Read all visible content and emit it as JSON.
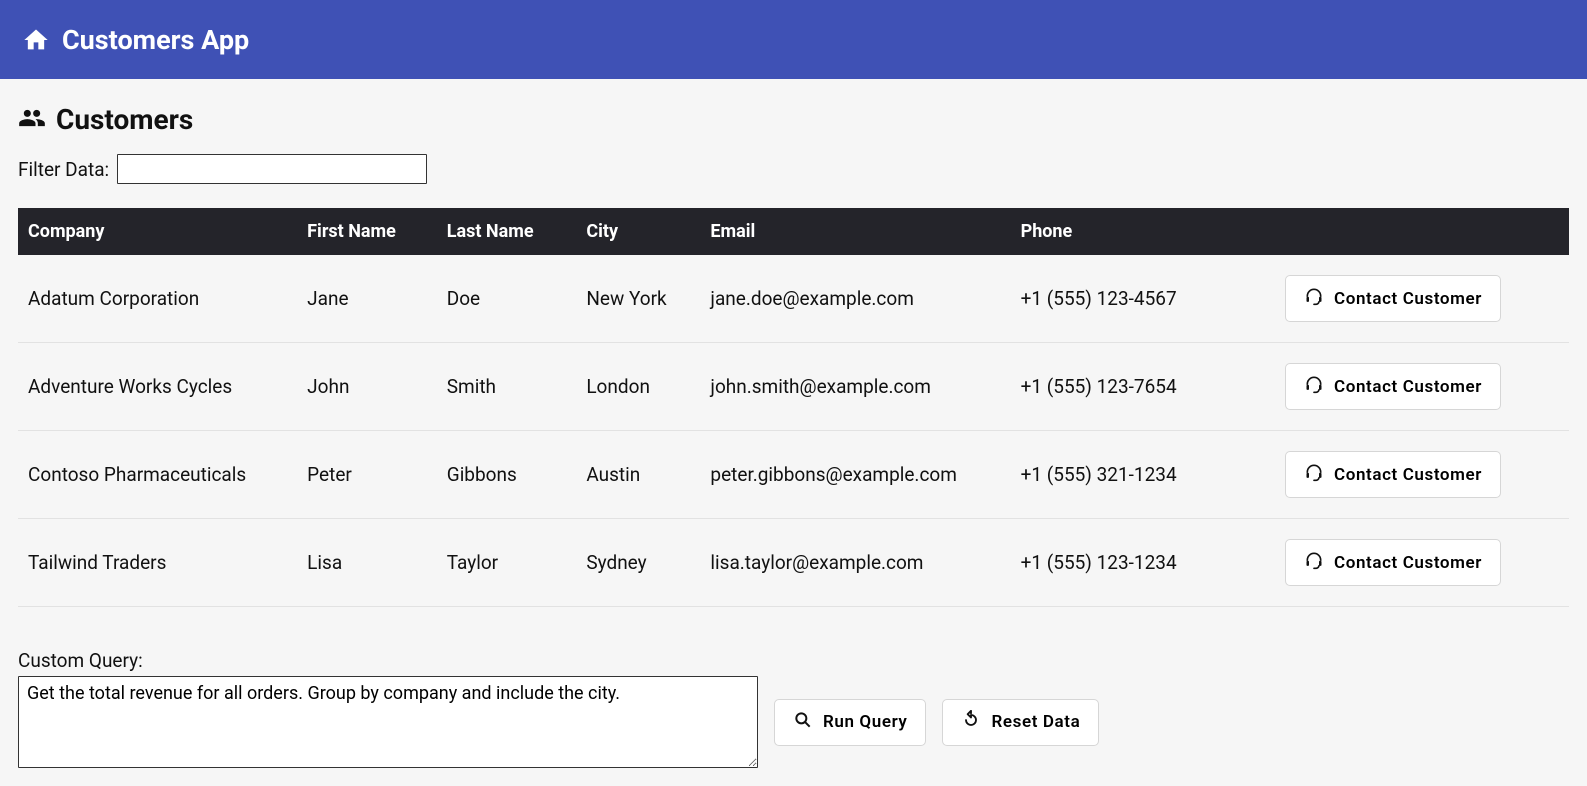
{
  "header": {
    "app_title": "Customers App"
  },
  "page": {
    "heading": "Customers",
    "filter_label": "Filter Data:",
    "filter_value": ""
  },
  "table": {
    "columns": {
      "company": "Company",
      "first_name": "First Name",
      "last_name": "Last Name",
      "city": "City",
      "email": "Email",
      "phone": "Phone"
    },
    "contact_button_label": "Contact Customer",
    "rows": [
      {
        "company": "Adatum Corporation",
        "first_name": "Jane",
        "last_name": "Doe",
        "city": "New York",
        "email": "jane.doe@example.com",
        "phone": "+1 (555) 123-4567"
      },
      {
        "company": "Adventure Works Cycles",
        "first_name": "John",
        "last_name": "Smith",
        "city": "London",
        "email": "john.smith@example.com",
        "phone": "+1 (555) 123-7654"
      },
      {
        "company": "Contoso Pharmaceuticals",
        "first_name": "Peter",
        "last_name": "Gibbons",
        "city": "Austin",
        "email": "peter.gibbons@example.com",
        "phone": "+1 (555) 321-1234"
      },
      {
        "company": "Tailwind Traders",
        "first_name": "Lisa",
        "last_name": "Taylor",
        "city": "Sydney",
        "email": "lisa.taylor@example.com",
        "phone": "+1 (555) 123-1234"
      }
    ]
  },
  "query": {
    "label": "Custom Query:",
    "value": "Get the total revenue for all orders. Group by company and include the city.",
    "run_label": "Run Query",
    "reset_label": "Reset Data"
  }
}
